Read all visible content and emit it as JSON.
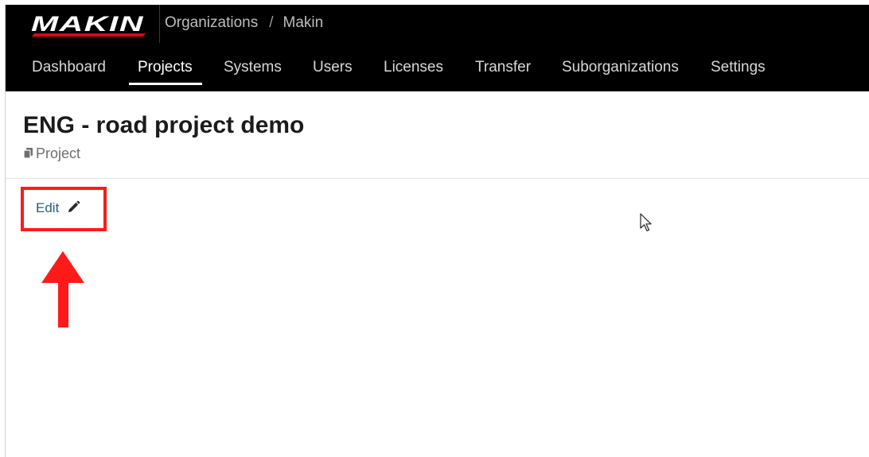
{
  "header": {
    "logo_text": "MAKIN",
    "breadcrumb": {
      "organizations": "Organizations",
      "separator": "/",
      "current": "Makin"
    }
  },
  "nav": {
    "items": [
      {
        "label": "Dashboard",
        "active": false
      },
      {
        "label": "Projects",
        "active": true
      },
      {
        "label": "Systems",
        "active": false
      },
      {
        "label": "Users",
        "active": false
      },
      {
        "label": "Licenses",
        "active": false
      },
      {
        "label": "Transfer",
        "active": false
      },
      {
        "label": "Suborganizations",
        "active": false
      },
      {
        "label": "Settings",
        "active": false
      }
    ]
  },
  "main": {
    "title": "ENG - road project demo",
    "type_label": "Project",
    "type_icon": "copy-icon",
    "edit_label": "Edit",
    "edit_icon": "pencil-icon"
  },
  "annotation": {
    "highlight_color": "#ff1a1a",
    "arrow_direction": "up"
  },
  "colors": {
    "topbar_bg": "#000000",
    "logo_red": "#e3001b",
    "link_blue": "#1e5d8c"
  }
}
